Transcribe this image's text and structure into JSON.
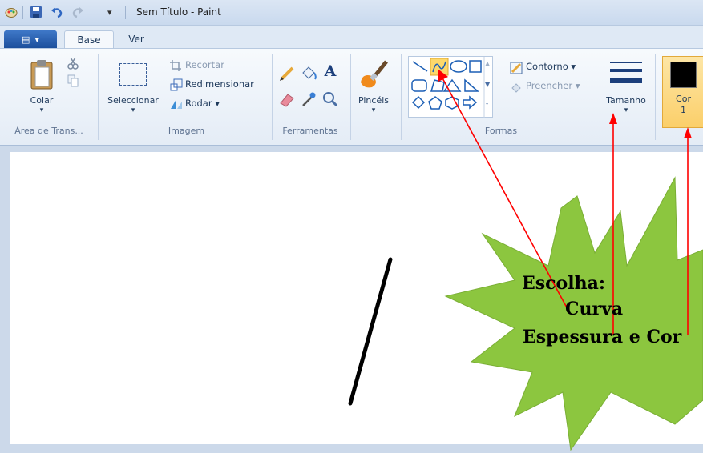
{
  "window": {
    "title": "Sem Título - Paint"
  },
  "tabs": [
    {
      "label": "Base",
      "active": true
    },
    {
      "label": "Ver",
      "active": false
    }
  ],
  "ribbon": {
    "clipboard": {
      "paste_label": "Colar",
      "group_label": "Área de Trans..."
    },
    "image": {
      "select_label": "Seleccionar",
      "crop_label": "Recortar",
      "resize_label": "Redimensionar",
      "rotate_label": "Rodar",
      "group_label": "Imagem"
    },
    "tools": {
      "group_label": "Ferramentas"
    },
    "brushes": {
      "label": "Pincéis"
    },
    "shapes": {
      "outline_label": "Contorno",
      "fill_label": "Preencher",
      "group_label": "Formas",
      "selected": "curve"
    },
    "size": {
      "label": "Tamanho"
    },
    "color": {
      "label_line1": "Cor",
      "label_line2": "1",
      "value": "#000000"
    }
  },
  "annotation": {
    "line1": "Escolha:",
    "line2": "Curva",
    "line3": "Espessura e Cor",
    "burst_color": "#8cc63f",
    "arrow_color": "#ff0000"
  }
}
